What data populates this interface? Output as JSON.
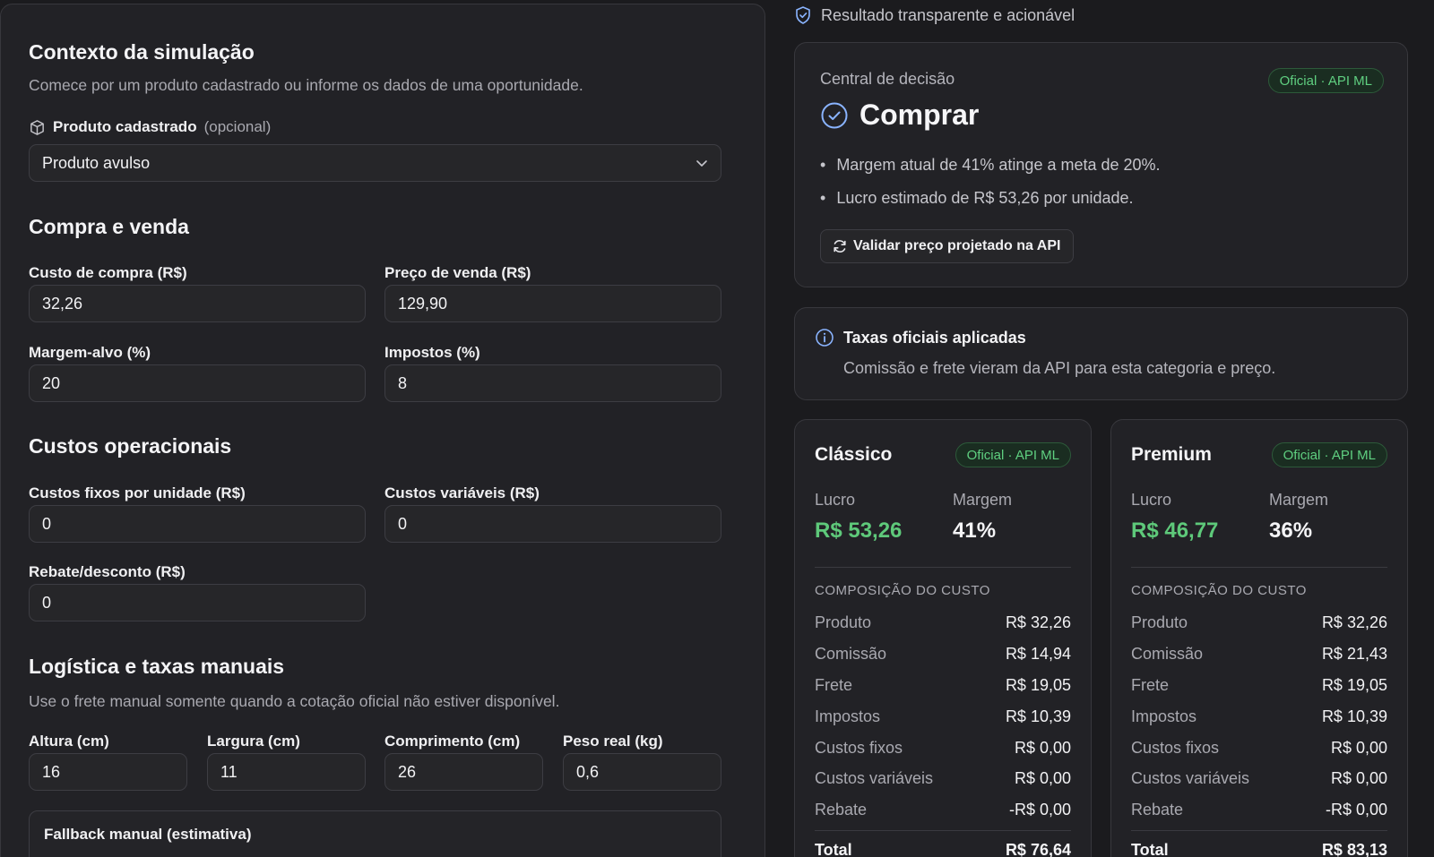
{
  "form": {
    "context": {
      "title": "Contexto da simulação",
      "desc": "Comece por um produto cadastrado ou informe os dados de uma oportunidade.",
      "product_label": "Produto cadastrado",
      "product_optional": "(opcional)",
      "product_value": "Produto avulso"
    },
    "buy_sell": {
      "title": "Compra e venda",
      "cost_label": "Custo de compra (R$)",
      "cost_value": "32,26",
      "price_label": "Preço de venda (R$)",
      "price_value": "129,90",
      "margin_label": "Margem-alvo (%)",
      "margin_value": "20",
      "tax_label": "Impostos (%)",
      "tax_value": "8"
    },
    "op_costs": {
      "title": "Custos operacionais",
      "fixed_label": "Custos fixos por unidade (R$)",
      "fixed_value": "0",
      "variable_label": "Custos variáveis (R$)",
      "variable_value": "0",
      "rebate_label": "Rebate/desconto (R$)",
      "rebate_value": "0"
    },
    "logistics": {
      "title": "Logística e taxas manuais",
      "desc": "Use o frete manual somente quando a cotação oficial não estiver disponível.",
      "height_label": "Altura (cm)",
      "height_value": "16",
      "width_label": "Largura (cm)",
      "width_value": "11",
      "length_label": "Comprimento (cm)",
      "length_value": "26",
      "weight_label": "Peso real (kg)",
      "weight_value": "0,6",
      "fallback_title": "Fallback manual (estimativa)"
    }
  },
  "result": {
    "header": "Resultado transparente e acionável",
    "decision": {
      "label": "Central de decisão",
      "badge": "Oficial · API ML",
      "verdict": "Comprar",
      "bullets": [
        "Margem atual de 41% atinge a meta de 20%.",
        "Lucro estimado de R$ 53,26 por unidade."
      ],
      "validate_button": "Validar preço projetado na API"
    },
    "fees": {
      "title": "Taxas oficiais aplicadas",
      "desc": "Comissão e frete vieram da API para esta categoria e preço."
    },
    "plans": [
      {
        "name": "Clássico",
        "badge": "Oficial · API ML",
        "profit_label": "Lucro",
        "profit": "R$ 53,26",
        "margin_label": "Margem",
        "margin": "41%",
        "comp_title": "COMPOSIÇÃO DO CUSTO",
        "rows": [
          {
            "k": "Produto",
            "v": "R$ 32,26"
          },
          {
            "k": "Comissão",
            "v": "R$ 14,94"
          },
          {
            "k": "Frete",
            "v": "R$ 19,05"
          },
          {
            "k": "Impostos",
            "v": "R$ 10,39"
          },
          {
            "k": "Custos fixos",
            "v": "R$ 0,00"
          },
          {
            "k": "Custos variáveis",
            "v": "R$ 0,00"
          },
          {
            "k": "Rebate",
            "v": "-R$ 0,00"
          }
        ],
        "total_label": "Total",
        "total": "R$ 76,64"
      },
      {
        "name": "Premium",
        "badge": "Oficial · API ML",
        "profit_label": "Lucro",
        "profit": "R$ 46,77",
        "margin_label": "Margem",
        "margin": "36%",
        "comp_title": "COMPOSIÇÃO DO CUSTO",
        "rows": [
          {
            "k": "Produto",
            "v": "R$ 32,26"
          },
          {
            "k": "Comissão",
            "v": "R$ 21,43"
          },
          {
            "k": "Frete",
            "v": "R$ 19,05"
          },
          {
            "k": "Impostos",
            "v": "R$ 10,39"
          },
          {
            "k": "Custos fixos",
            "v": "R$ 0,00"
          },
          {
            "k": "Custos variáveis",
            "v": "R$ 0,00"
          },
          {
            "k": "Rebate",
            "v": "-R$ 0,00"
          }
        ],
        "total_label": "Total",
        "total": "R$ 83,13"
      }
    ]
  },
  "colors": {
    "profit": "#5ec97a",
    "accent": "#8ab4ff",
    "badge_text": "#5fcf80"
  }
}
